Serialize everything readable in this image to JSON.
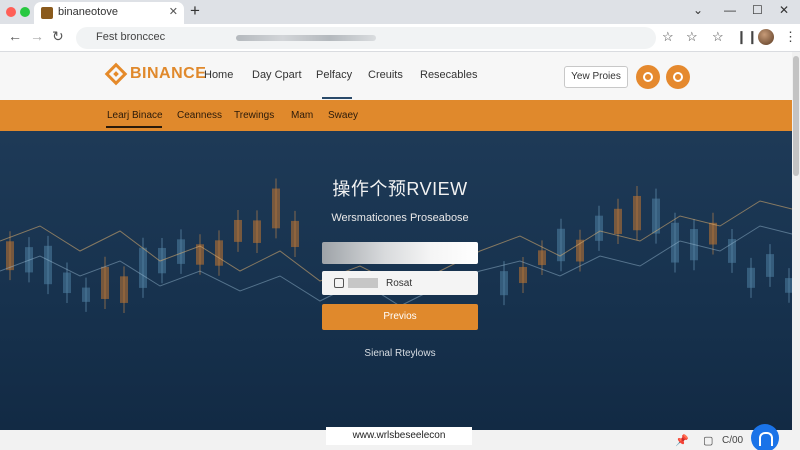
{
  "browser": {
    "tab_title": "binaneotove",
    "tab_close": "✕",
    "new_tab": "+",
    "address": "Fest bronccec",
    "controls": {
      "minimize": "⌄",
      "restore": "—",
      "maximize": "☐",
      "close": "✕"
    },
    "toolbar_icons": [
      "star-icon",
      "star-outline-icon",
      "bookmark-star-icon",
      "split-icon",
      "menu-dots-icon"
    ]
  },
  "site": {
    "logo": "BINANCE",
    "nav": [
      "Home",
      "Day Cpart",
      "Pelfacy",
      "Creuits",
      "Resecables"
    ],
    "review_button": "Yew Proies"
  },
  "subnav": [
    "Learj Binace",
    "Ceanness",
    "Trewings",
    "Mam",
    "Swaey"
  ],
  "hero": {
    "title": "操作个预RVIEW",
    "subtitle": "Wersmaticones Proseabose",
    "input2_value": "Rosat",
    "cta": "Previos",
    "link": "Sienal Rteylows"
  },
  "status": {
    "url": "www.wrlsbeseelecon",
    "icons": [
      "pin-icon",
      "chat-icon"
    ],
    "text": "C/00"
  },
  "colors": {
    "accent": "#e0892c",
    "hero_bg": "#17324e",
    "fab": "#1a73e8"
  }
}
